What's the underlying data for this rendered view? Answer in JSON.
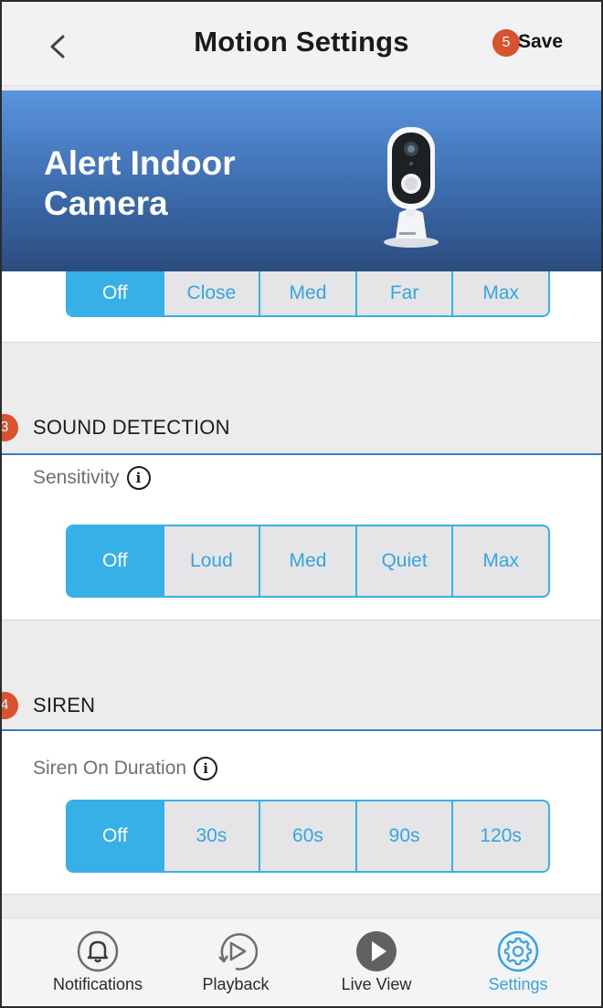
{
  "header": {
    "title": "Motion Settings",
    "save_label": "Save",
    "save_badge": "5"
  },
  "banner": {
    "title": "Alert Indoor Camera"
  },
  "motion_detection": {
    "options": [
      "Off",
      "Close",
      "Med",
      "Far",
      "Max"
    ],
    "selected": "Off"
  },
  "sound_detection": {
    "badge": "3",
    "title": "SOUND DETECTION",
    "sensitivity_label": "Sensitivity",
    "options": [
      "Off",
      "Loud",
      "Med",
      "Quiet",
      "Max"
    ],
    "selected": "Off"
  },
  "siren": {
    "badge": "4",
    "title": "SIREN",
    "duration_label": "Siren On Duration",
    "options": [
      "Off",
      "30s",
      "60s",
      "90s",
      "120s"
    ],
    "selected": "Off"
  },
  "bottom_nav": {
    "items": [
      {
        "label": "Notifications",
        "icon": "bell-icon"
      },
      {
        "label": "Playback",
        "icon": "playback-icon"
      },
      {
        "label": "Live View",
        "icon": "play-icon"
      },
      {
        "label": "Settings",
        "icon": "gear-icon"
      }
    ],
    "active": "Settings"
  },
  "colors": {
    "accent": "#37b0e8",
    "badge": "#d9522e",
    "banner_top": "#5a95df",
    "banner_bottom": "#2a4c7e"
  }
}
